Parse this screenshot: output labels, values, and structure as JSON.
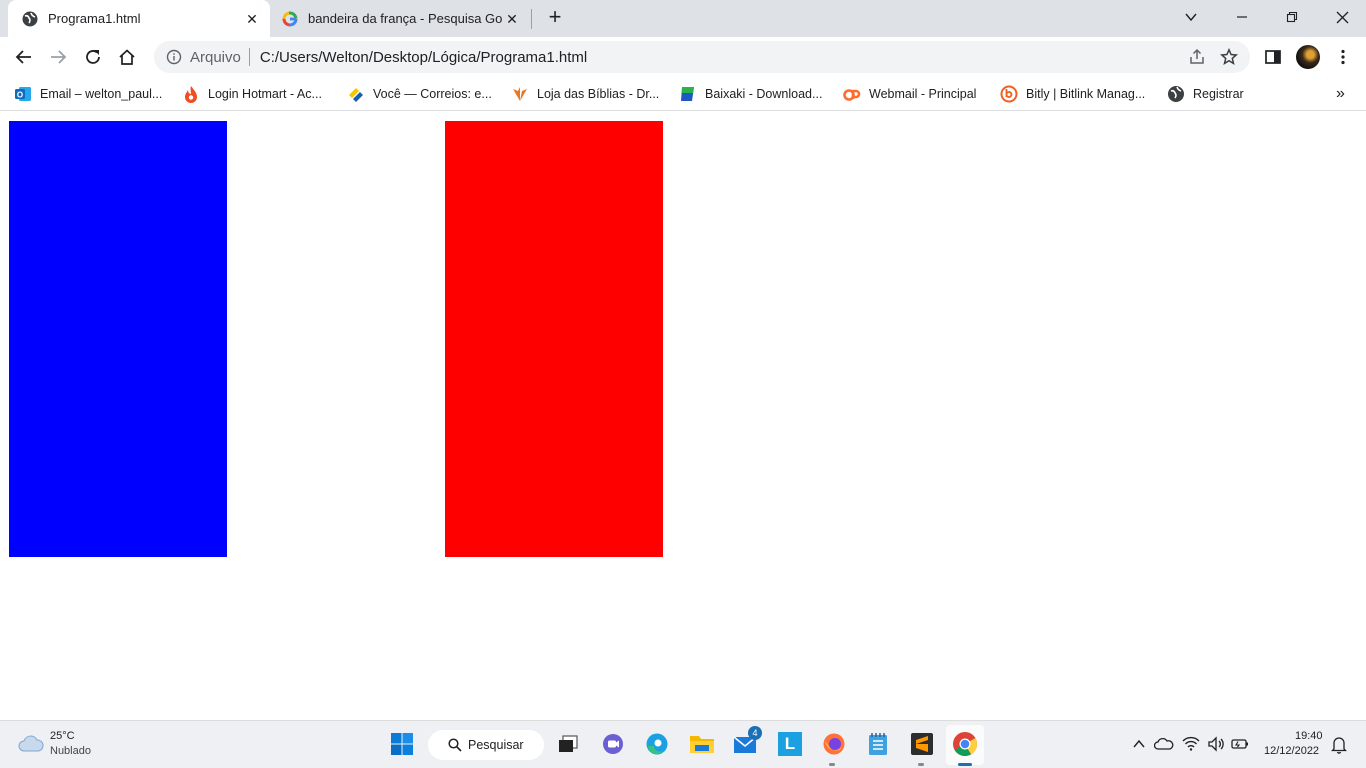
{
  "browser": {
    "tabs": [
      {
        "title": "Programa1.html",
        "active": true
      },
      {
        "title": "bandeira da frança - Pesquisa Go",
        "active": false
      }
    ],
    "address": {
      "chip": "Arquivo",
      "url": "C:/Users/Welton/Desktop/Lógica/Programa1.html"
    },
    "bookmarks": [
      {
        "label": "Email – welton_paul...",
        "icon": "outlook-icon",
        "color": "#0f6cbd"
      },
      {
        "label": "Login Hotmart - Ac...",
        "icon": "hotmart-flame-icon",
        "color": "#f04e23"
      },
      {
        "label": "Você — Correios: e...",
        "icon": "correios-icon",
        "color": "#f7c600"
      },
      {
        "label": "Loja das Bíblias - Dr...",
        "icon": "bible-store-icon",
        "color": "#e87722"
      },
      {
        "label": "Baixaki - Download...",
        "icon": "baixaki-icon",
        "color": "#1f57c3"
      },
      {
        "label": "Webmail - Principal",
        "icon": "cpanel-icon",
        "color": "#ff6c2c"
      },
      {
        "label": "Bitly | Bitlink Manag...",
        "icon": "bitly-icon",
        "color": "#ee6123"
      },
      {
        "label": "Registrar",
        "icon": "globe-icon",
        "color": "#3c4043"
      }
    ]
  },
  "page": {
    "flag_colors": {
      "left": "#0000ff",
      "middle": "#ffffff",
      "right": "#ff0000"
    }
  },
  "taskbar": {
    "weather": {
      "temp": "25°C",
      "condition": "Nublado"
    },
    "search_label": "Pesquisar",
    "mail_badge": "4",
    "clock": {
      "time": "19:40",
      "date": "12/12/2022"
    }
  }
}
